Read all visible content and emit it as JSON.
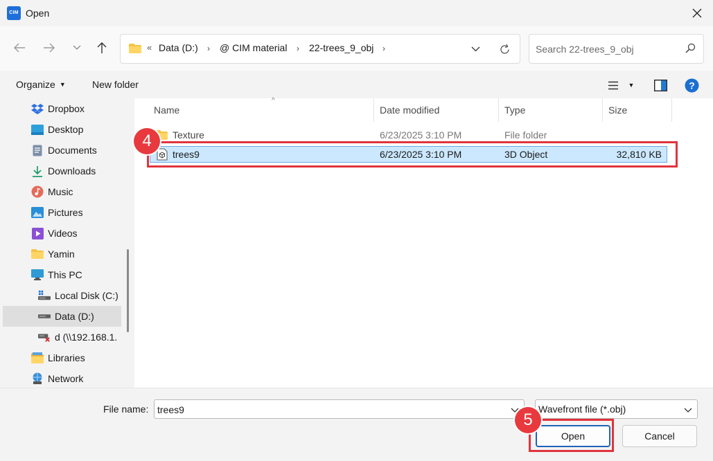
{
  "window": {
    "title": "Open",
    "app_icon_text": "CIM"
  },
  "address": {
    "overflow": "«",
    "crumbs": [
      "Data (D:)",
      "@ CIM material",
      "22-trees_9_obj"
    ]
  },
  "search": {
    "placeholder": "Search 22-trees_9_obj"
  },
  "toolbar": {
    "organize": "Organize",
    "new_folder": "New folder"
  },
  "sidebar": {
    "items": [
      {
        "label": "Dropbox",
        "icon": "dropbox-icon"
      },
      {
        "label": "Desktop",
        "icon": "desktop-icon"
      },
      {
        "label": "Documents",
        "icon": "documents-icon"
      },
      {
        "label": "Downloads",
        "icon": "downloads-icon"
      },
      {
        "label": "Music",
        "icon": "music-icon"
      },
      {
        "label": "Pictures",
        "icon": "pictures-icon"
      },
      {
        "label": "Videos",
        "icon": "videos-icon"
      },
      {
        "label": "Yamin",
        "icon": "folder-icon"
      },
      {
        "label": "This PC",
        "icon": "this-pc-icon"
      },
      {
        "label": "Local Disk (C:)",
        "icon": "drive-icon"
      },
      {
        "label": "Data (D:)",
        "icon": "drive-icon"
      },
      {
        "label": "d (\\\\192.168.1.",
        "icon": "network-drive-icon"
      },
      {
        "label": "Libraries",
        "icon": "libraries-icon"
      },
      {
        "label": "Network",
        "icon": "network-icon"
      }
    ],
    "selected_label": "Data (D:)"
  },
  "columns": {
    "name": "Name",
    "date": "Date modified",
    "type": "Type",
    "size": "Size"
  },
  "files": [
    {
      "name": "Texture",
      "date": "6/23/2025 3:10 PM",
      "type": "File folder",
      "size": "",
      "icon": "folder-icon"
    },
    {
      "name": "trees9",
      "date": "6/23/2025 3:10 PM",
      "type": "3D Object",
      "size": "32,810 KB",
      "icon": "3d-object-icon"
    }
  ],
  "selected_file": "trees9",
  "bottom": {
    "file_name_label": "File name:",
    "file_name_value": "trees9",
    "file_type": "Wavefront file (*.obj)",
    "open_label": "Open",
    "cancel_label": "Cancel"
  },
  "annotations": {
    "step4": "4",
    "step5": "5",
    "color": "#e0343c"
  },
  "colors": {
    "accent": "#1e6fd9",
    "selection": "#cce8ff",
    "annotation": "#e0343c"
  }
}
